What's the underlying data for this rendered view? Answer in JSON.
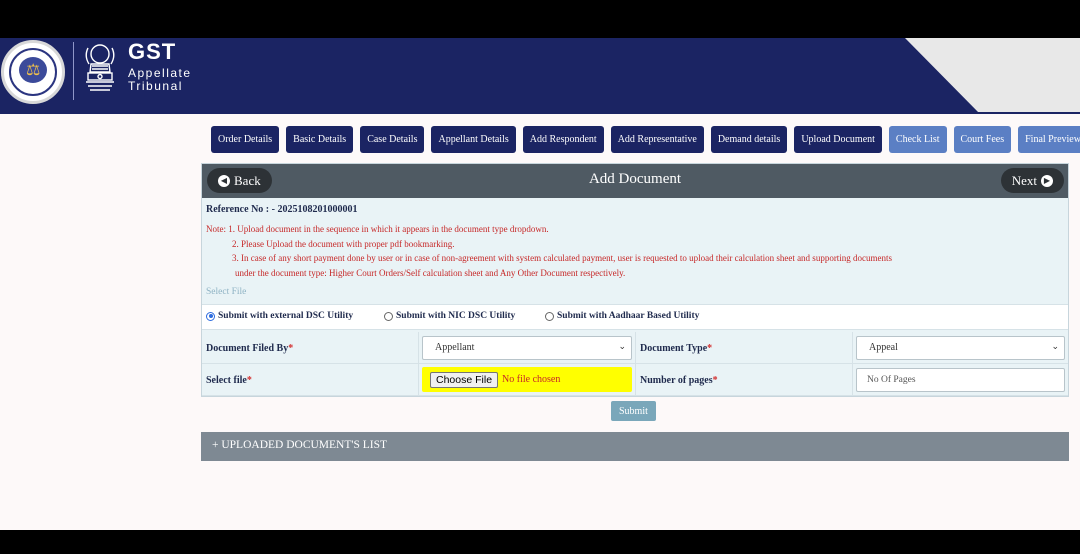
{
  "header": {
    "brand_title": "GST",
    "brand_sub1": "Appellate",
    "brand_sub2": "Tribunal",
    "colors": {
      "navy": "#1b2463",
      "light": "#e8e8e8"
    }
  },
  "steps": [
    {
      "label": "Order Details",
      "state": "done"
    },
    {
      "label": "Basic Details",
      "state": "done"
    },
    {
      "label": "Case Details",
      "state": "done"
    },
    {
      "label": "Appellant Details",
      "state": "done"
    },
    {
      "label": "Add Respondent",
      "state": "done"
    },
    {
      "label": "Add Representative",
      "state": "done"
    },
    {
      "label": "Demand details",
      "state": "done"
    },
    {
      "label": "Upload Document",
      "state": "current"
    },
    {
      "label": "Check List",
      "state": "pending"
    },
    {
      "label": "Court Fees",
      "state": "pending"
    },
    {
      "label": "Final Preview",
      "state": "pending"
    }
  ],
  "panel": {
    "back_label": "Back",
    "back_icon": "chevron-left-circle-icon",
    "title": "Add Document",
    "next_label": "Next",
    "next_icon": "chevron-right-circle-icon",
    "reference": "Reference No : - 2025108201000001",
    "notes": [
      "Note: 1. Upload document in the sequence in which it appears in the document type dropdown.",
      "2. Please Upload the document with proper pdf bookmarking.",
      "3. In case of any short payment done by user or in case of non-agreement with system calculated payment, user is requested to upload their calculation sheet and supporting documents",
      "under the document type: Higher Court Orders/Self calculation sheet and Any Other Document respectively."
    ],
    "select_file_label": "Select File"
  },
  "submit_options": [
    {
      "label": "Submit with external DSC Utility",
      "checked": true
    },
    {
      "label": "Submit with NIC DSC Utility",
      "checked": false
    },
    {
      "label": "Submit with Aadhaar Based Utility",
      "checked": false
    }
  ],
  "form": {
    "filed_by_label": "Document Filed By",
    "filed_by_value": "Appellant",
    "doc_type_label": "Document Type",
    "doc_type_value": "Appeal",
    "select_file_label": "Select file",
    "choose_file_label": "Choose File",
    "no_file_text": "No file chosen",
    "pages_label": "Number of pages",
    "pages_placeholder": "No Of Pages",
    "required_mark": "*",
    "submit_label": "Submit"
  },
  "uploaded_list_label": "+ UPLOADED DOCUMENT'S LIST"
}
